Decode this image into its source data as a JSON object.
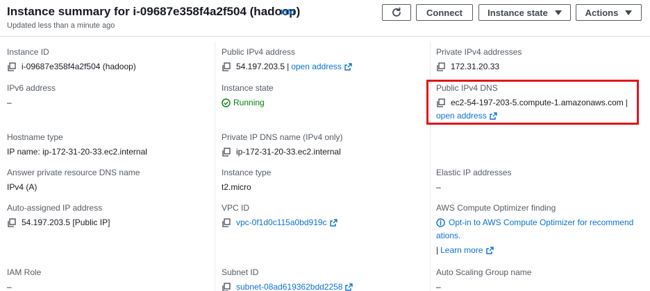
{
  "header": {
    "title": "Instance summary for i-09687e358f4a2f504 (hadoop)",
    "info": "Info",
    "updated": "Updated less than a minute ago",
    "buttons": {
      "connect": "Connect",
      "instance_state": "Instance state",
      "actions": "Actions"
    }
  },
  "fields": {
    "instance_id": {
      "label": "Instance ID",
      "value": "i-09687e358f4a2f504 (hadoop)"
    },
    "public_ipv4": {
      "label": "Public IPv4 address",
      "value": "54.197.203.5",
      "sep": "|",
      "link": "open address"
    },
    "private_ipv4": {
      "label": "Private IPv4 addresses",
      "value": "172.31.20.33"
    },
    "ipv6": {
      "label": "IPv6 address",
      "value": "–"
    },
    "instance_state": {
      "label": "Instance state",
      "value": "Running"
    },
    "public_dns": {
      "label": "Public IPv4 DNS",
      "value": "ec2-54-197-203-5.compute-1.amazonaws.com",
      "sep": "|",
      "link": "open address"
    },
    "hostname_type": {
      "label": "Hostname type",
      "value": "IP name: ip-172-31-20-33.ec2.internal"
    },
    "private_dns": {
      "label": "Private IP DNS name (IPv4 only)",
      "value": "ip-172-31-20-33.ec2.internal"
    },
    "answer_dns": {
      "label": "Answer private resource DNS name",
      "value": "IPv4 (A)"
    },
    "instance_type": {
      "label": "Instance type",
      "value": "t2.micro"
    },
    "elastic_ip": {
      "label": "Elastic IP addresses",
      "value": "–"
    },
    "auto_ip": {
      "label": "Auto-assigned IP address",
      "value": "54.197.203.5 [Public IP]"
    },
    "vpc_id": {
      "label": "VPC ID",
      "value": "vpc-0f1d0c115a0bd919c"
    },
    "optimizer": {
      "label": "AWS Compute Optimizer finding",
      "line1": "Opt-in to AWS Compute Optimizer for recommend",
      "line2": "ations.",
      "sep": "|",
      "learn": "Learn more"
    },
    "iam_role": {
      "label": "IAM Role",
      "value": "–"
    },
    "subnet_id": {
      "label": "Subnet ID",
      "value": "subnet-08ad619362bdd2258"
    },
    "asg_name": {
      "label": "Auto Scaling Group name",
      "value": "–"
    }
  },
  "colors": {
    "link": "#0972d3",
    "running": "#037f0c",
    "highlight": "#e0151b",
    "text": "#16191f",
    "label": "#545b64"
  }
}
